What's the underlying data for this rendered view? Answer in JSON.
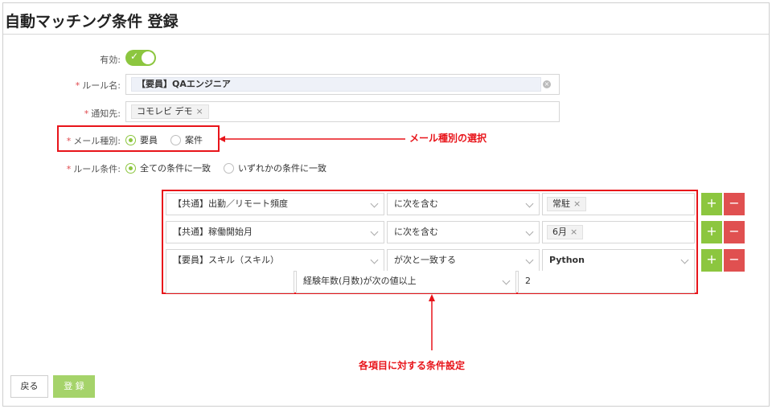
{
  "page": {
    "title": "自動マッチング条件 登録"
  },
  "form": {
    "enabled_label": "有効:",
    "enabled": true,
    "rule_name_label": "ルール名:",
    "rule_name_value": "【要員】QAエンジニア",
    "notify_label": "通知先:",
    "notify_tag": "コモレビ デモ",
    "mail_type_label": "メール種別:",
    "mail_type_options": [
      "要員",
      "案件"
    ],
    "mail_type_selected": "要員",
    "rule_cond_label": "ルール条件:",
    "rule_cond_options": [
      "全ての条件に一致",
      "いずれかの条件に一致"
    ],
    "rule_cond_selected": "全ての条件に一致",
    "required_mark": "*"
  },
  "conditions": [
    {
      "field": "【共通】出勤／リモート頻度",
      "operator": "に次を含む",
      "value_tag": "常駐"
    },
    {
      "field": "【共通】稼働開始月",
      "operator": "に次を含む",
      "value_tag": "6月"
    },
    {
      "field": "【要員】スキル（スキル）",
      "operator": "が次と一致する",
      "value_select": "Python",
      "sub": {
        "field": "経験年数(月数)が次の値以上",
        "value": "2"
      }
    }
  ],
  "buttons": {
    "back": "戻る",
    "save": "登 録",
    "add": "+",
    "remove": "−",
    "remove_tag": "×"
  },
  "annotations": {
    "mail_type": "メール種別の選択",
    "conditions": "各項目に対する条件設定"
  },
  "colors": {
    "accent": "#8cc63f",
    "danger": "#e05050",
    "annotation": "#e8141a"
  }
}
